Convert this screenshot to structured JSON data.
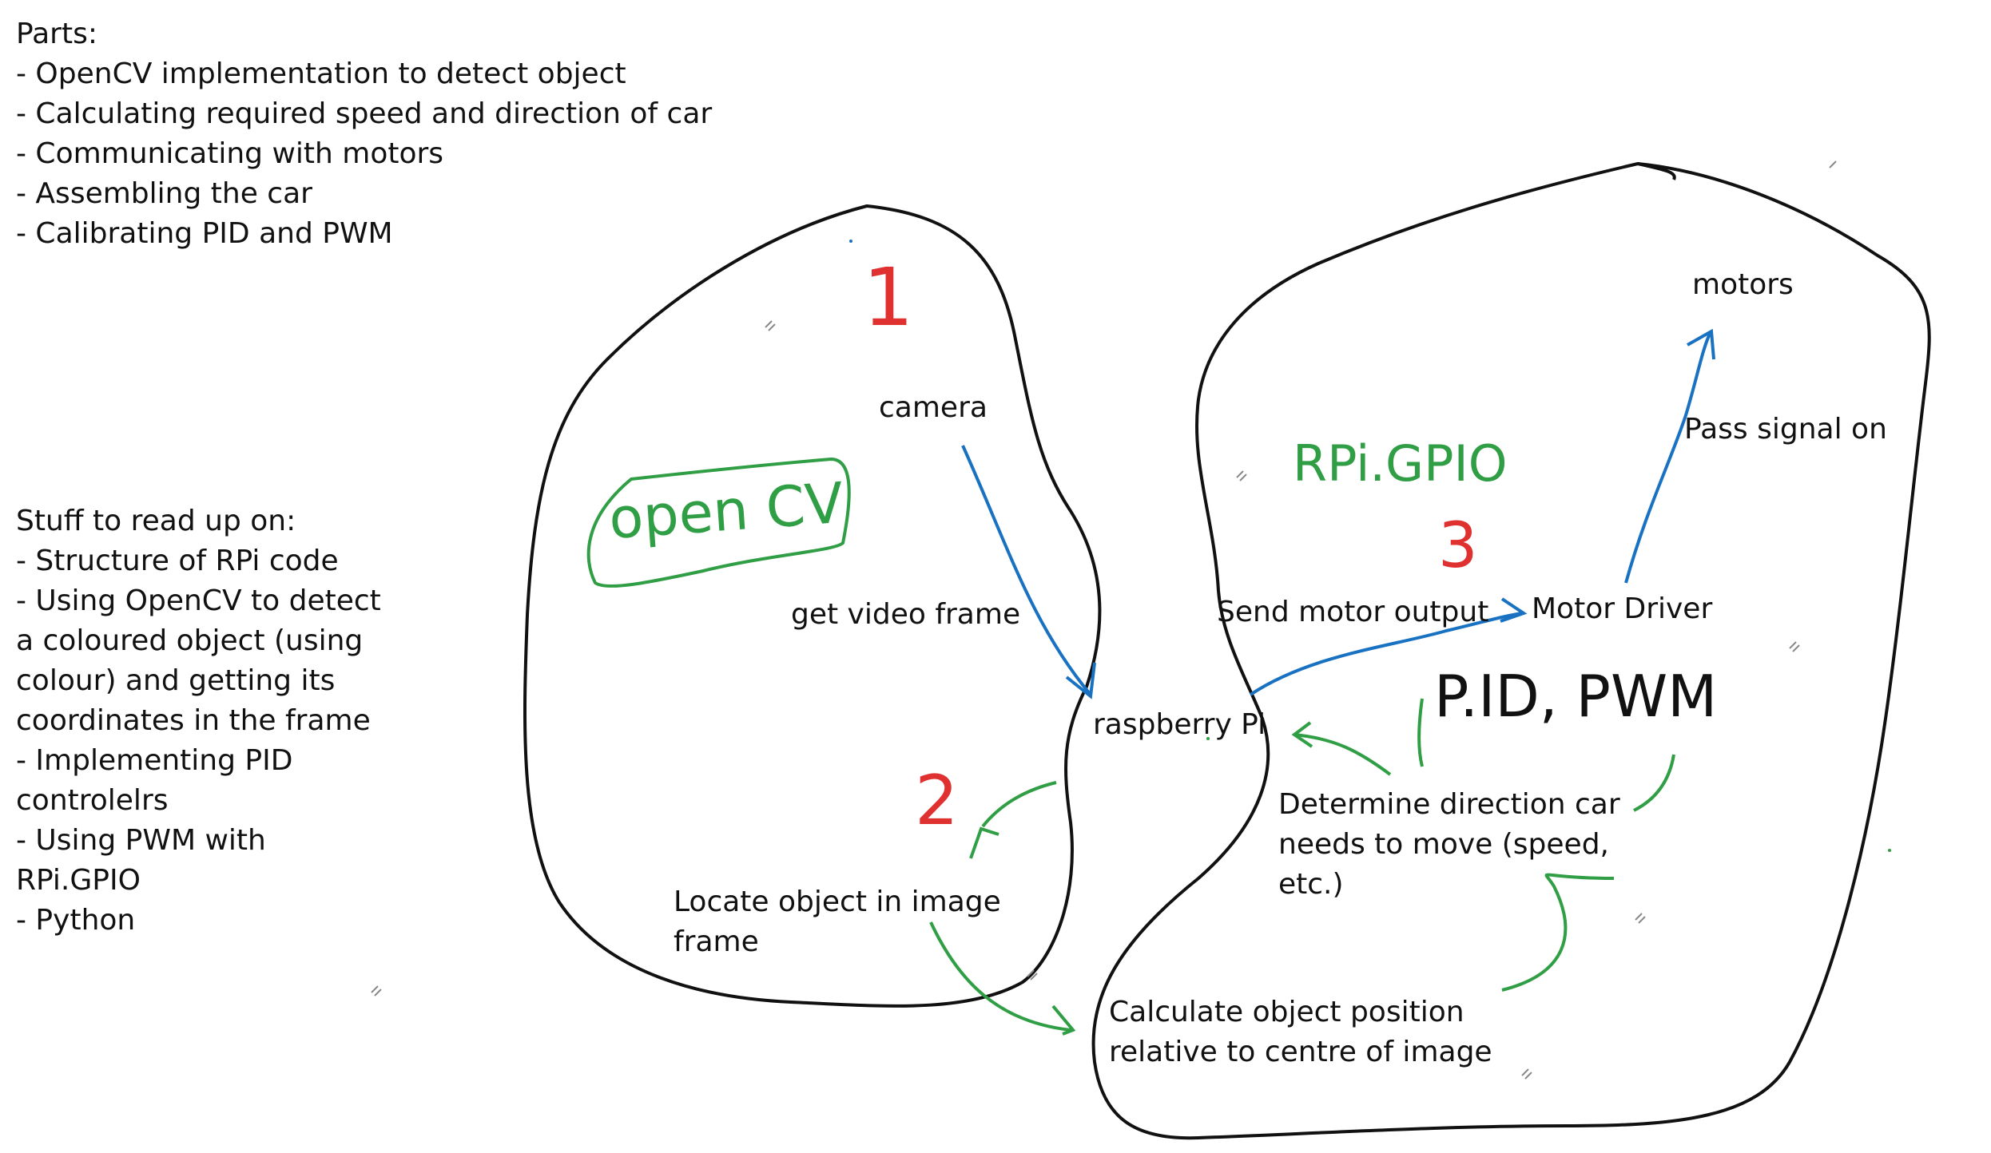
{
  "parts": {
    "heading": "Parts:",
    "items": [
      "- OpenCV implementation to detect object",
      "- Calculating required speed and direction of car",
      "- Communicating with motors",
      "- Assembling the car",
      "- Calibrating PID and PWM"
    ]
  },
  "reading": {
    "heading": "Stuff to read up on:",
    "items": [
      "- Structure of RPi code",
      "- Using OpenCV to detect",
      "a coloured object (using",
      "colour) and getting its",
      "coordinates in the frame",
      "- Implementing PID",
      "controlelrs",
      "- Using PWM with",
      "RPi.GPIO",
      "- Python"
    ]
  },
  "nodes": {
    "camera": "camera",
    "get_video_frame": "get video frame",
    "raspberry_pi": "raspberry Pi",
    "locate_object_line1": "Locate object in image",
    "locate_object_line2": "frame",
    "calc_position_line1": "Calculate object position",
    "calc_position_line2": "relative to centre of image",
    "determine_line1": "Determine direction car",
    "determine_line2": "needs to move (speed,",
    "determine_line3": "etc.)",
    "send_motor_output": "Send motor output",
    "motor_driver": "Motor Driver",
    "pass_signal_on": "Pass signal on",
    "motors": "motors"
  },
  "annotations": {
    "opencv": "open CV",
    "rpi_gpio": "RPi.GPIO",
    "pid_pwm": "P.ID, PWM",
    "num1": "1",
    "num2": "2",
    "num3": "3"
  },
  "colors": {
    "ink": "#111111",
    "red": "#e03131",
    "green": "#2f9e44",
    "blue": "#1971c2"
  }
}
